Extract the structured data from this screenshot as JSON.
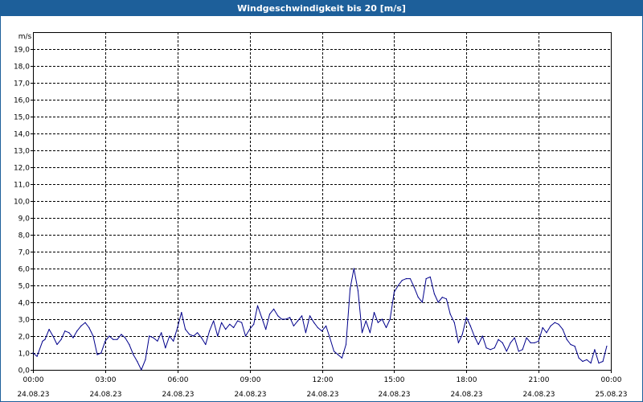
{
  "window": {
    "title": "Windgeschwindigkeit bis 20 [m/s]"
  },
  "chart_data": {
    "type": "line",
    "title": "Windgeschwindigkeit bis 20 [m/s]",
    "ylabel": "m/s",
    "xlabel": "",
    "ylim": [
      0,
      20
    ],
    "xlim_hours": [
      0,
      24
    ],
    "grid": true,
    "y_ticks": [
      "0,0",
      "1,0",
      "2,0",
      "3,0",
      "4,0",
      "5,0",
      "6,0",
      "7,0",
      "8,0",
      "9,0",
      "10,0",
      "11,0",
      "12,0",
      "13,0",
      "14,0",
      "15,0",
      "16,0",
      "17,0",
      "18,0",
      "19,0"
    ],
    "x_ticks": [
      {
        "time": "00:00",
        "date": "24.08.23"
      },
      {
        "time": "03:00",
        "date": "24.08.23"
      },
      {
        "time": "06:00",
        "date": "24.08.23"
      },
      {
        "time": "09:00",
        "date": "24.08.23"
      },
      {
        "time": "12:00",
        "date": "24.08.23"
      },
      {
        "time": "15:00",
        "date": "24.08.23"
      },
      {
        "time": "18:00",
        "date": "24.08.23"
      },
      {
        "time": "21:00",
        "date": "24.08.23"
      },
      {
        "time": "00:00",
        "date": "25.08.23"
      }
    ],
    "series": [
      {
        "color": "#00008b",
        "x": [
          0.0,
          0.17,
          0.4,
          0.5,
          0.67,
          0.83,
          1.0,
          1.17,
          1.33,
          1.5,
          1.67,
          1.83,
          2.0,
          2.17,
          2.33,
          2.5,
          2.67,
          2.83,
          3.0,
          3.17,
          3.33,
          3.5,
          3.67,
          3.83,
          4.0,
          4.17,
          4.33,
          4.5,
          4.67,
          4.83,
          5.0,
          5.17,
          5.33,
          5.5,
          5.67,
          5.83,
          6.0,
          6.17,
          6.33,
          6.5,
          6.67,
          6.83,
          7.0,
          7.17,
          7.33,
          7.5,
          7.67,
          7.83,
          8.0,
          8.17,
          8.33,
          8.5,
          8.67,
          8.83,
          9.0,
          9.17,
          9.33,
          9.5,
          9.67,
          9.83,
          10.0,
          10.17,
          10.33,
          10.5,
          10.67,
          10.83,
          11.0,
          11.17,
          11.33,
          11.5,
          11.67,
          11.83,
          12.0,
          12.17,
          12.33,
          12.5,
          12.67,
          12.83,
          13.0,
          13.17,
          13.33,
          13.5,
          13.67,
          13.83,
          14.0,
          14.17,
          14.33,
          14.5,
          14.67,
          14.83,
          15.0,
          15.17,
          15.33,
          15.5,
          15.67,
          15.83,
          16.0,
          16.17,
          16.33,
          16.5,
          16.67,
          16.83,
          17.0,
          17.17,
          17.33,
          17.5,
          17.67,
          17.83,
          18.0,
          18.17,
          18.33,
          18.5,
          18.67,
          18.83,
          19.0,
          19.17,
          19.33,
          19.5,
          19.67,
          19.83,
          20.0,
          20.17,
          20.33,
          20.5,
          20.67,
          20.83,
          21.0,
          21.17,
          21.33,
          21.5,
          21.67,
          21.83,
          22.0,
          22.17,
          22.33,
          22.5,
          22.67,
          22.83,
          23.0,
          23.17,
          23.33,
          23.5,
          23.67,
          23.83
        ],
        "values": [
          1.0,
          0.8,
          1.7,
          1.8,
          2.4,
          2.0,
          1.5,
          1.8,
          2.3,
          2.2,
          1.9,
          2.3,
          2.6,
          2.8,
          2.5,
          2.0,
          0.9,
          1.0,
          1.7,
          2.0,
          1.8,
          1.8,
          2.1,
          1.9,
          1.5,
          0.9,
          0.5,
          0.0,
          0.6,
          2.0,
          1.9,
          1.7,
          2.2,
          1.3,
          2.0,
          1.7,
          2.5,
          3.4,
          2.4,
          2.1,
          2.0,
          2.2,
          1.9,
          1.5,
          2.3,
          2.9,
          2.0,
          2.8,
          2.4,
          2.7,
          2.5,
          2.9,
          2.8,
          2.0,
          2.4,
          2.7,
          3.8,
          3.1,
          2.4,
          3.3,
          3.6,
          3.2,
          3.0,
          3.0,
          3.1,
          2.6,
          2.9,
          3.2,
          2.2,
          3.2,
          2.8,
          2.5,
          2.3,
          2.6,
          1.9,
          1.1,
          0.9,
          0.7,
          1.5,
          4.8,
          6.0,
          4.7,
          2.2,
          2.9,
          2.2,
          3.4,
          2.8,
          3.0,
          2.5,
          3.0,
          4.6,
          5.0,
          5.3,
          5.4,
          5.4,
          4.9,
          4.3,
          4.0,
          5.4,
          5.5,
          4.5,
          4.0,
          4.3,
          4.2,
          3.3,
          2.8,
          1.6,
          2.1,
          3.1,
          2.6,
          2.0,
          1.5,
          2.0,
          1.3,
          1.2,
          1.3,
          1.8,
          1.6,
          1.1,
          1.6,
          1.9,
          1.1,
          1.2,
          1.9,
          1.6,
          1.6,
          1.7,
          2.5,
          2.2,
          2.6,
          2.8,
          2.7,
          2.4,
          1.8,
          1.5,
          1.4,
          0.7,
          0.5,
          0.6,
          0.4,
          1.2,
          0.4,
          0.5,
          1.4
        ]
      }
    ]
  }
}
